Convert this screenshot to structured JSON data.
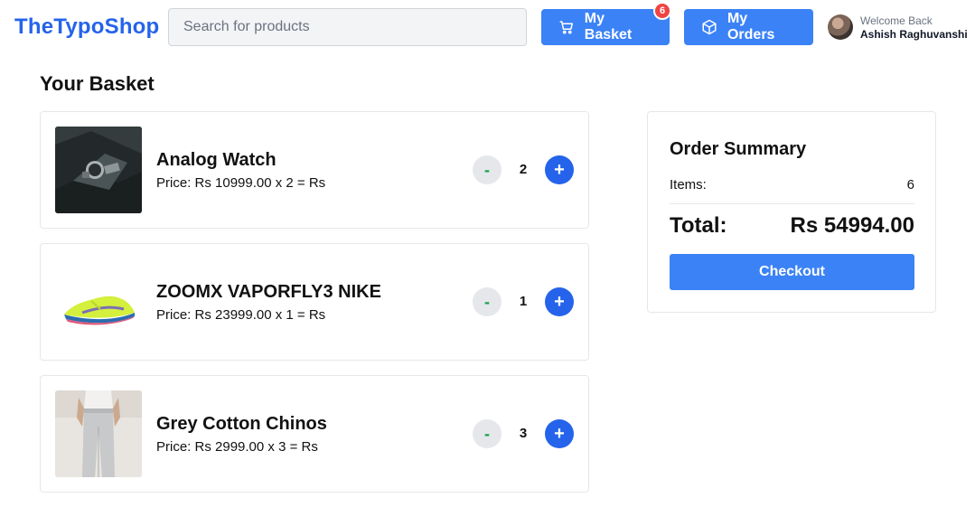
{
  "header": {
    "brand": "TheTypoShop",
    "search_placeholder": "Search for products",
    "basket_label": "My Basket",
    "basket_count": "6",
    "orders_label": "My Orders",
    "welcome": "Welcome Back",
    "user_name": "Ashish Raghuvanshi"
  },
  "page_title": "Your Basket",
  "cart": {
    "items": [
      {
        "name": "Analog Watch",
        "price_text": "Price: Rs 10999.00 x 2 = Rs",
        "quantity": "2",
        "minus": "-",
        "plus": "+"
      },
      {
        "name": "ZOOMX VAPORFLY3 NIKE",
        "price_text": "Price: Rs 23999.00 x 1 = Rs",
        "quantity": "1",
        "minus": "-",
        "plus": "+"
      },
      {
        "name": "Grey Cotton Chinos",
        "price_text": "Price: Rs 2999.00 x 3 = Rs",
        "quantity": "3",
        "minus": "-",
        "plus": "+"
      }
    ]
  },
  "summary": {
    "title": "Order Summary",
    "items_label": "Items:",
    "items_value": "6",
    "total_label": "Total:",
    "total_value": "Rs 54994.00",
    "checkout_label": "Checkout"
  },
  "colors": {
    "brand": "#2563eb",
    "primary_button": "#3b82f6",
    "badge": "#ef4444",
    "minus_text": "#16a34a"
  },
  "icons": {
    "basket": "cart-icon",
    "orders": "box-icon"
  }
}
